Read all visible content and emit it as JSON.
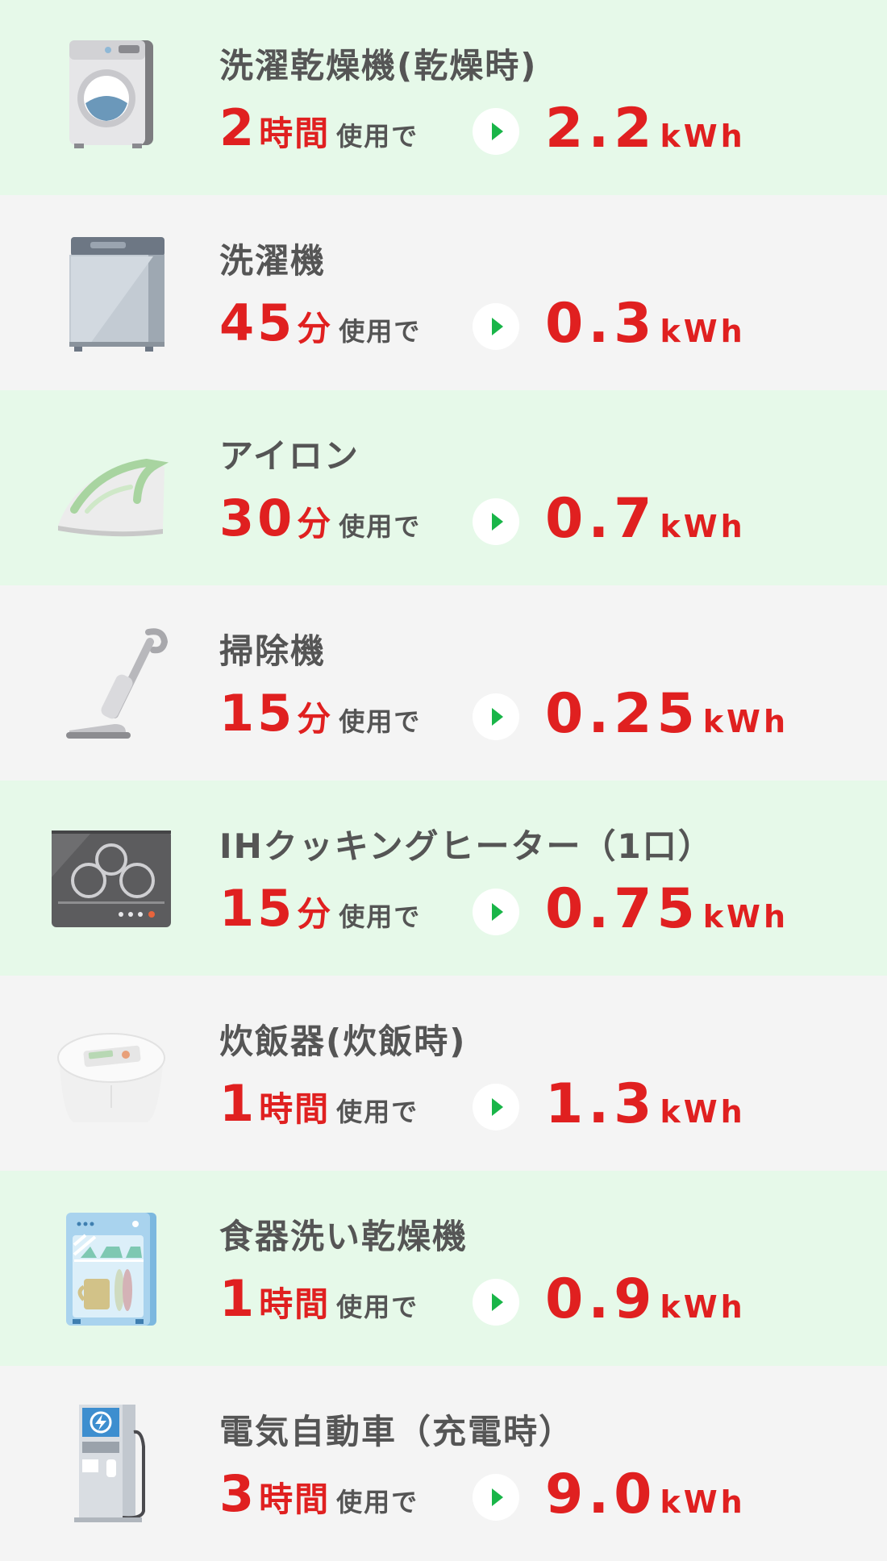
{
  "colors": {
    "green_row": "#e6f9e9",
    "gray_row": "#f4f4f4",
    "red": "#e02020",
    "text_gray": "#555555",
    "arrow_green": "#19b548"
  },
  "rows": [
    {
      "name": "洗濯乾燥機(乾燥時)",
      "amount": "2",
      "amount_unit": "時間",
      "suffix": "使用で",
      "value": "2.2",
      "value_unit": "kWh",
      "icon": "washer-dryer-icon",
      "bg": "green"
    },
    {
      "name": "洗濯機",
      "amount": "45",
      "amount_unit": "分",
      "suffix": "使用で",
      "value": "0.3",
      "value_unit": "kWh",
      "icon": "washing-machine-icon",
      "bg": "gray"
    },
    {
      "name": "アイロン",
      "amount": "30",
      "amount_unit": "分",
      "suffix": "使用で",
      "value": "0.7",
      "value_unit": "kWh",
      "icon": "iron-icon",
      "bg": "green"
    },
    {
      "name": "掃除機",
      "amount": "15",
      "amount_unit": "分",
      "suffix": "使用で",
      "value": "0.25",
      "value_unit": "kWh",
      "icon": "vacuum-cleaner-icon",
      "bg": "gray"
    },
    {
      "name": "IHクッキングヒーター（1口）",
      "amount": "15",
      "amount_unit": "分",
      "suffix": "使用で",
      "value": "0.75",
      "value_unit": "kWh",
      "icon": "ih-cooktop-icon",
      "bg": "green"
    },
    {
      "name": "炊飯器(炊飯時)",
      "amount": "1",
      "amount_unit": "時間",
      "suffix": "使用で",
      "value": "1.3",
      "value_unit": "kWh",
      "icon": "rice-cooker-icon",
      "bg": "gray"
    },
    {
      "name": "食器洗い乾燥機",
      "amount": "1",
      "amount_unit": "時間",
      "suffix": "使用で",
      "value": "0.9",
      "value_unit": "kWh",
      "icon": "dishwasher-icon",
      "bg": "green"
    },
    {
      "name": "電気自動車（充電時）",
      "amount": "3",
      "amount_unit": "時間",
      "suffix": "使用で",
      "value": "9.0",
      "value_unit": "kWh",
      "icon": "ev-charger-icon",
      "bg": "gray"
    }
  ]
}
